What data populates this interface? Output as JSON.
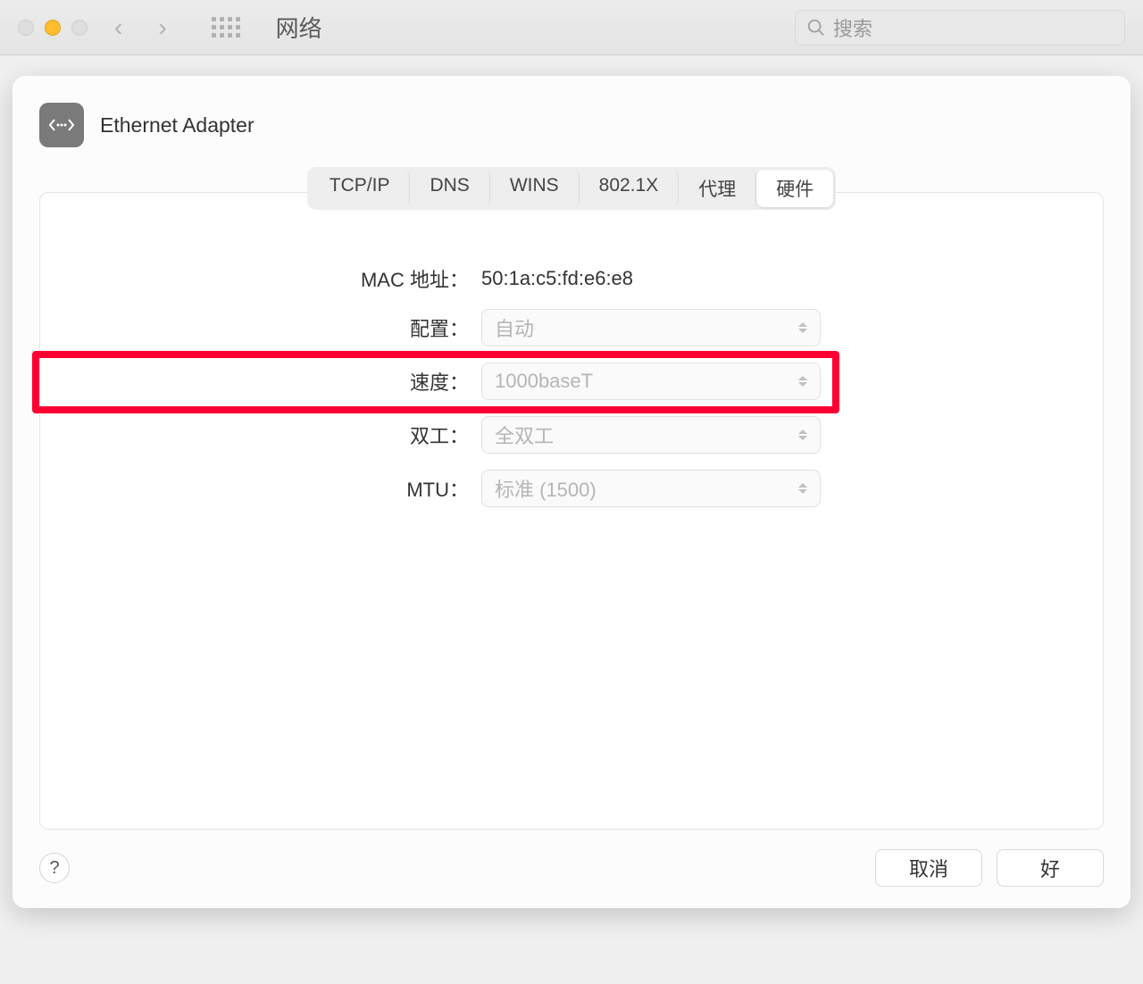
{
  "titlebar": {
    "title": "网络",
    "search_placeholder": "搜索"
  },
  "sheet": {
    "adapter_name": "Ethernet Adapter",
    "tabs": [
      "TCP/IP",
      "DNS",
      "WINS",
      "802.1X",
      "代理",
      "硬件"
    ],
    "active_tab_index": 5,
    "fields": {
      "mac_label": "MAC 地址：",
      "mac_value": "50:1a:c5:fd:e6:e8",
      "config_label": "配置：",
      "config_value": "自动",
      "speed_label": "速度：",
      "speed_value": "1000baseT",
      "duplex_label": "双工：",
      "duplex_value": "全双工",
      "mtu_label": "MTU：",
      "mtu_value": "标准 (1500)"
    },
    "footer": {
      "help": "?",
      "cancel": "取消",
      "ok": "好"
    }
  }
}
